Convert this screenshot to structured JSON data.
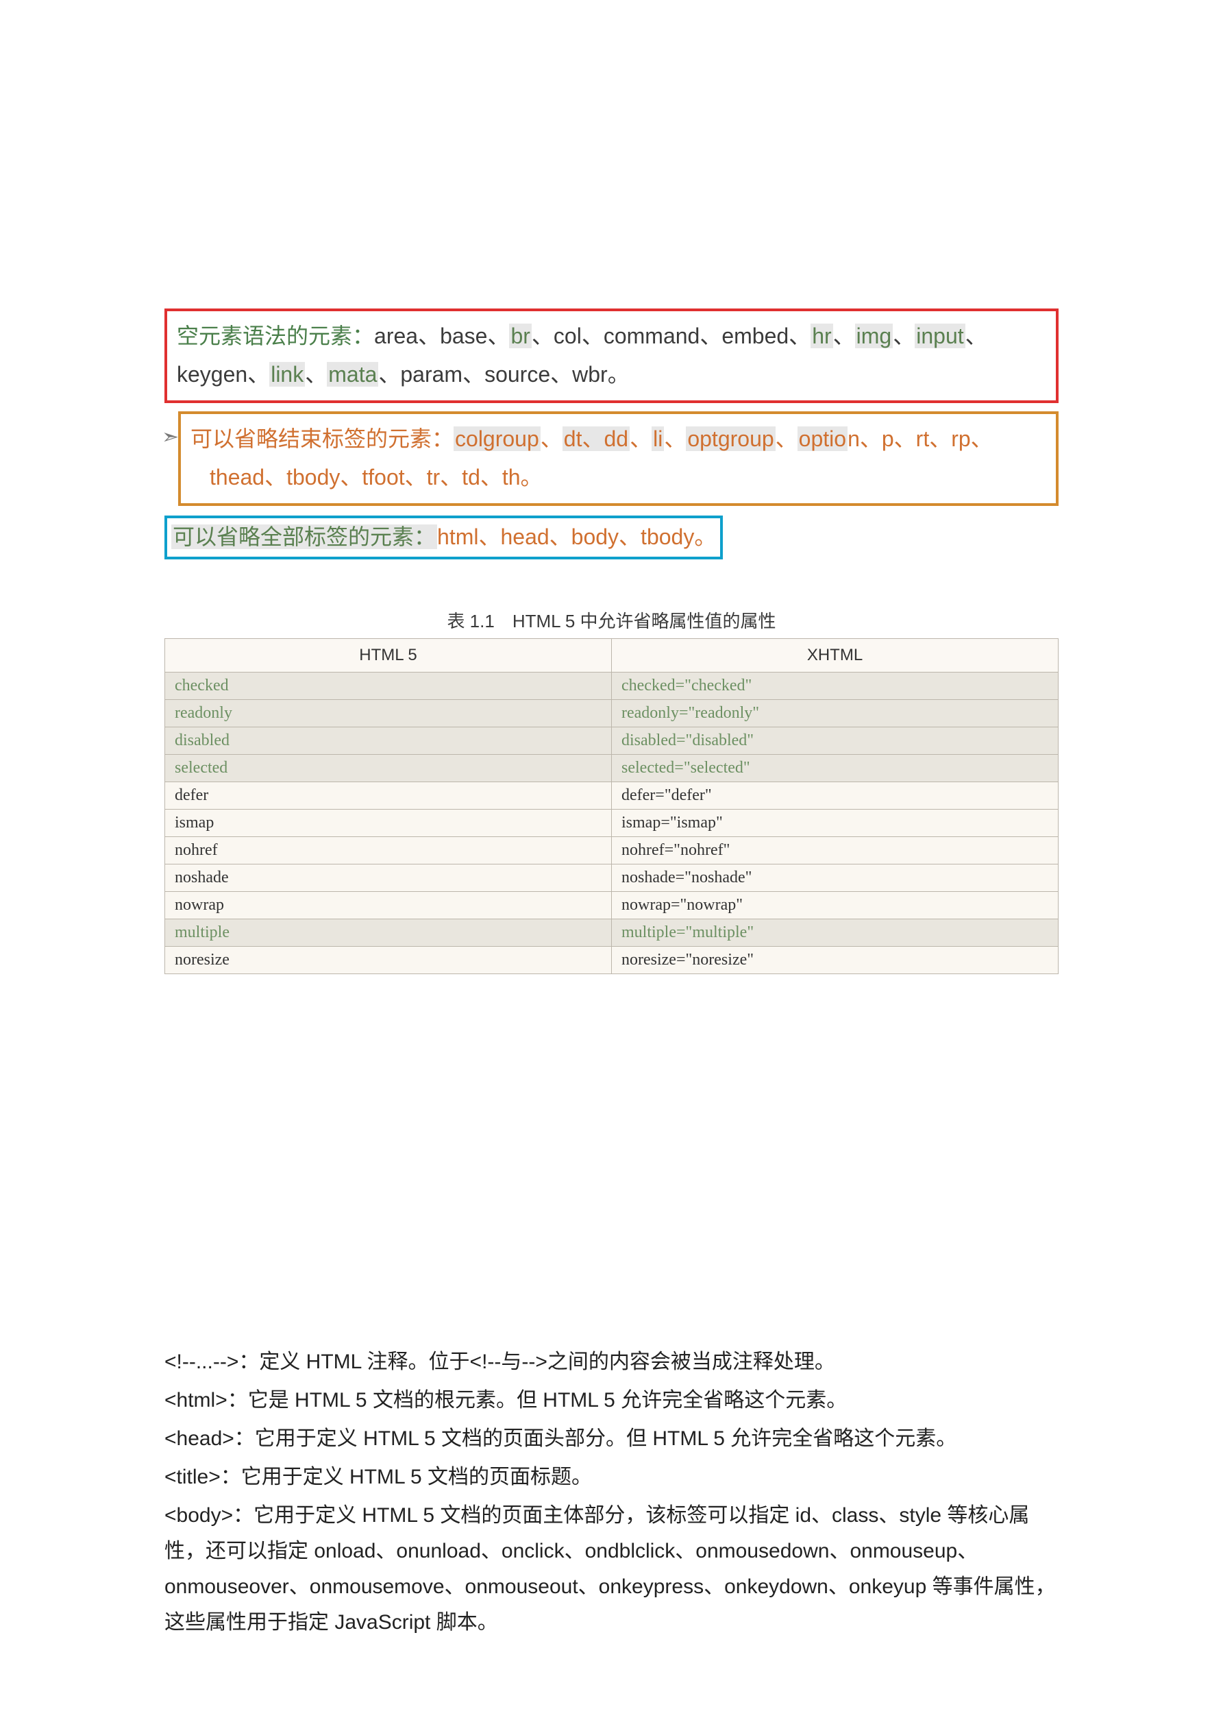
{
  "boxes": {
    "box1_prefix": "空元素语法的元素：",
    "box1_text_a": "area、base、",
    "box1_hl_br": "br",
    "box1_text_b": "、col、command、embed、",
    "box1_hl_hr": "hr",
    "box1_sep1": "、",
    "box1_hl_img": "img",
    "box1_sep2": "、",
    "box1_hl_input": "input",
    "box1_sep3": "、",
    "box1_line2_a": "keygen、",
    "box1_hl_link": "link",
    "box1_line2_b": "、",
    "box1_hl_mata": "mata",
    "box1_line2_c": "、param、source、wbr。",
    "box2_bullet": "➣",
    "box2_prefix": "可以省略结束标签的元素：",
    "box2_hl_colgroup": "colgroup",
    "box2_text_a": "、",
    "box2_hl_dt": "dt、dd",
    "box2_text_b": "、",
    "box2_hl_li": "li",
    "box2_text_c": "、",
    "box2_hl_optgroup": "optgroup",
    "box2_text_d": "、",
    "box2_hl_option": "optio",
    "box2_text_e": "n、p、rt、rp、",
    "box2_line2": "thead、tbody、tfoot、tr、td、th。",
    "box3_prefix": "可以省略全部标签的元素：",
    "box3_rest": "html、head、body、tbody。"
  },
  "table": {
    "caption": "表 1.1　HTML 5 中允许省略属性值的属性",
    "headers": [
      "HTML 5",
      "XHTML"
    ],
    "rows": [
      {
        "hl": true,
        "c1": "checked",
        "c2": "checked=\"checked\""
      },
      {
        "hl": true,
        "c1": "readonly",
        "c2": "readonly=\"readonly\""
      },
      {
        "hl": true,
        "c1": "disabled",
        "c2": "disabled=\"disabled\""
      },
      {
        "hl": true,
        "c1": "selected",
        "c2": "selected=\"selected\""
      },
      {
        "hl": false,
        "c1": "defer",
        "c2": "defer=\"defer\""
      },
      {
        "hl": false,
        "c1": "ismap",
        "c2": "ismap=\"ismap\""
      },
      {
        "hl": false,
        "c1": "nohref",
        "c2": "nohref=\"nohref\""
      },
      {
        "hl": false,
        "c1": "noshade",
        "c2": "noshade=\"noshade\""
      },
      {
        "hl": false,
        "c1": "nowrap",
        "c2": "nowrap=\"nowrap\""
      },
      {
        "hl": true,
        "c1": "multiple",
        "c2": "multiple=\"multiple\""
      },
      {
        "hl": false,
        "c1": "noresize",
        "c2": "noresize=\"noresize\""
      }
    ]
  },
  "defs": {
    "p1": "<!--...-->：定义 HTML 注释。位于<!--与-->之间的内容会被当成注释处理。",
    "p2": "<html>：它是 HTML 5 文档的根元素。但 HTML 5 允许完全省略这个元素。",
    "p3": "<head>：它用于定义 HTML 5 文档的页面头部分。但 HTML 5 允许完全省略这个元素。",
    "p4": "<title>：它用于定义 HTML 5 文档的页面标题。",
    "p5": "<body>：它用于定义 HTML 5 文档的页面主体部分，该标签可以指定 id、class、style 等核心属性，还可以指定 onload、onunload、onclick、ondblclick、onmousedown、onmouseup、onmouseover、onmousemove、onmouseout、onkeypress、onkeydown、onkeyup 等事件属性，这些属性用于指定 JavaScript 脚本。"
  }
}
